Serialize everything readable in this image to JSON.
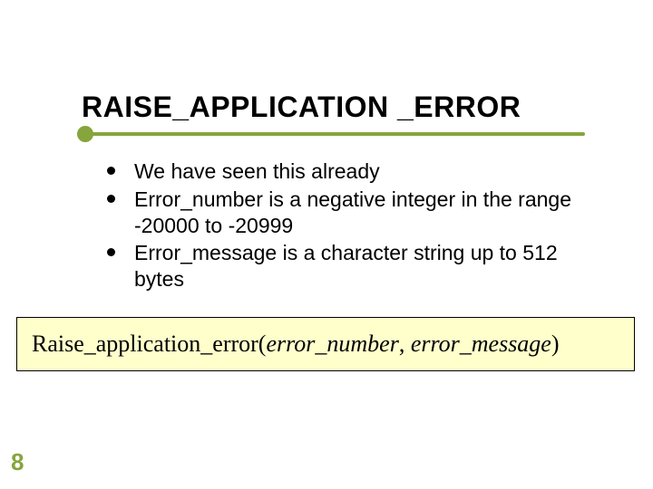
{
  "slide": {
    "title": "RAISE_APPLICATION _ERROR",
    "bullets": [
      "We have seen this already",
      "Error_number is a negative integer in the range -20000 to -20999",
      "Error_message is a character string up to 512 bytes"
    ],
    "code": {
      "fn": "Raise_application_error(",
      "arg1": "error_number",
      "comma": ", ",
      "arg2": "error_message",
      "close": ")"
    },
    "page_number": "8"
  }
}
